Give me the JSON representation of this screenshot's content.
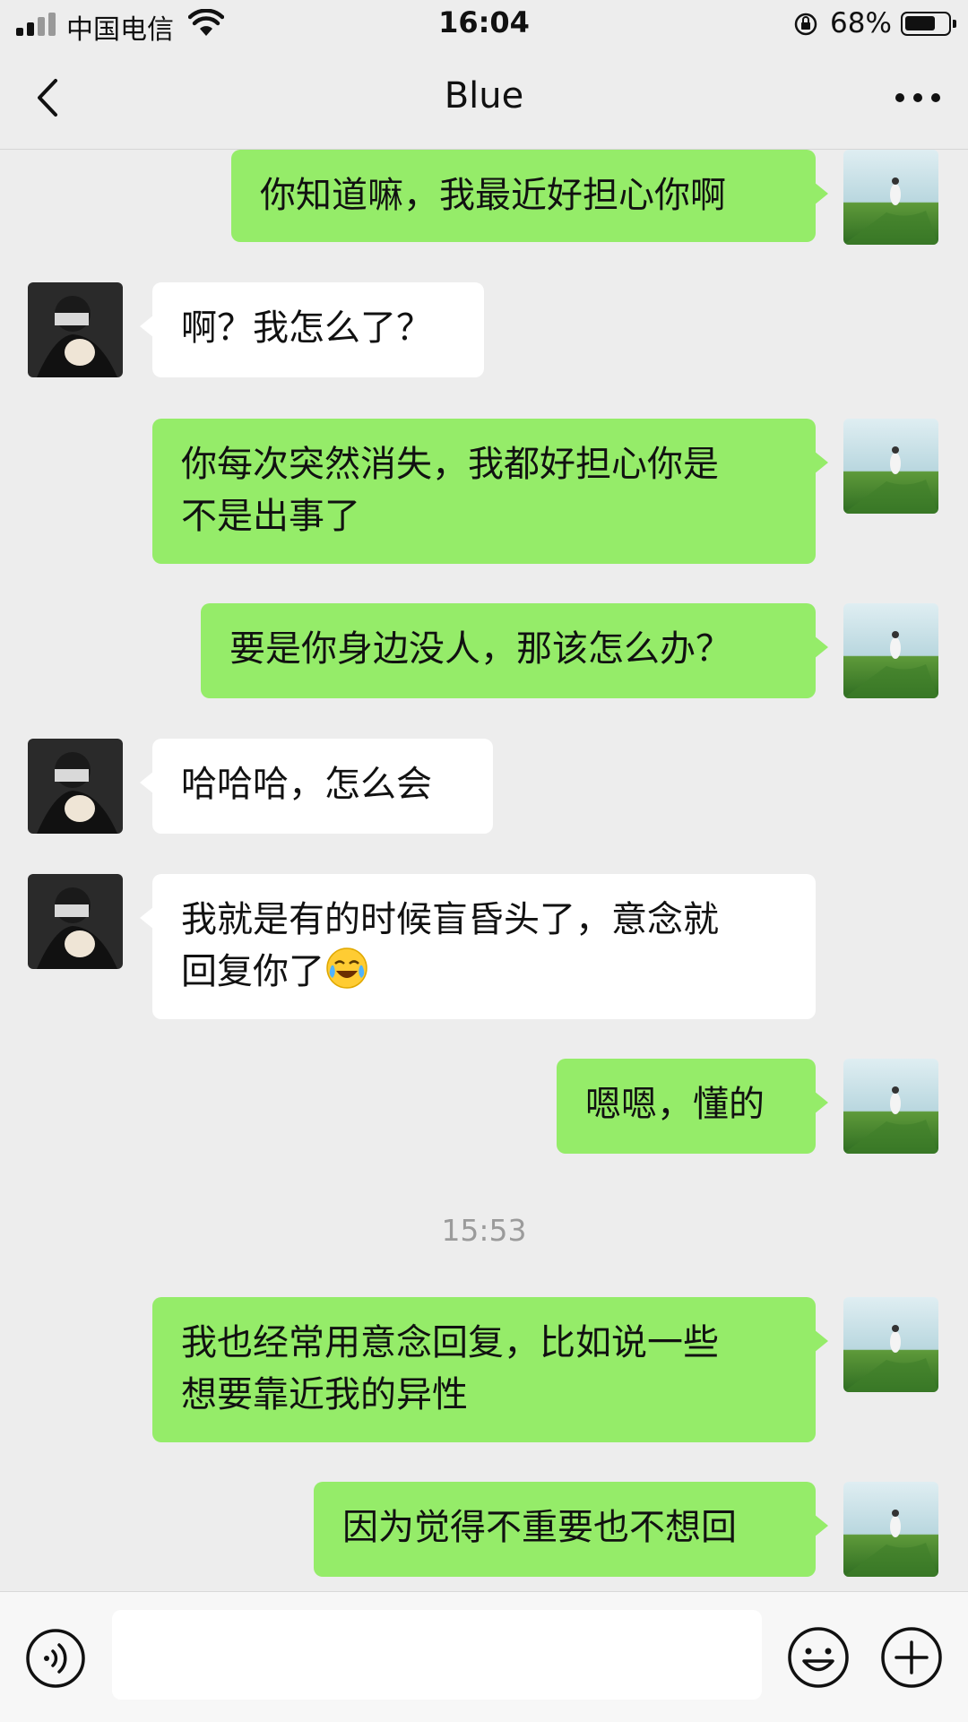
{
  "status_bar": {
    "carrier": "中国电信",
    "time": "16:04",
    "battery_percent": "68%",
    "battery_level": 0.68,
    "icons": [
      "signal-icon",
      "wifi-icon",
      "orientation-lock-icon",
      "battery-icon"
    ]
  },
  "nav": {
    "title": "Blue",
    "icons": [
      "back-icon",
      "more-icon"
    ]
  },
  "messages": [
    {
      "from": "me",
      "text": "你知道嘛，我最近好担心你啊"
    },
    {
      "from": "contact",
      "text": "啊？我怎么了？"
    },
    {
      "from": "me",
      "line1": "你每次突然消失，我都好担心你是",
      "line2": "不是出事了"
    },
    {
      "from": "me",
      "text": "要是你身边没人，那该怎么办？"
    },
    {
      "from": "contact",
      "text": "哈哈哈，怎么会"
    },
    {
      "from": "contact",
      "line1": "我就是有的时候盲昏头了，意念就",
      "line2": "回复你了",
      "emoji": "crying-laughing-emoji"
    },
    {
      "from": "me",
      "text": "嗯嗯，懂的"
    },
    {
      "from": "me",
      "line1": "我也经常用意念回复，比如说一些",
      "line2": "想要靠近我的异性"
    },
    {
      "from": "me",
      "text": "因为觉得不重要也不想回"
    }
  ],
  "timestamp": "15:53",
  "input_bar": {
    "value": "",
    "icons": [
      "voice-icon",
      "emoji-icon",
      "plus-icon"
    ]
  },
  "colors": {
    "background": "#ededed",
    "outgoing_bubble": "#95ec69",
    "incoming_bubble": "#ffffff",
    "timestamp_text": "#9b9b9b"
  }
}
